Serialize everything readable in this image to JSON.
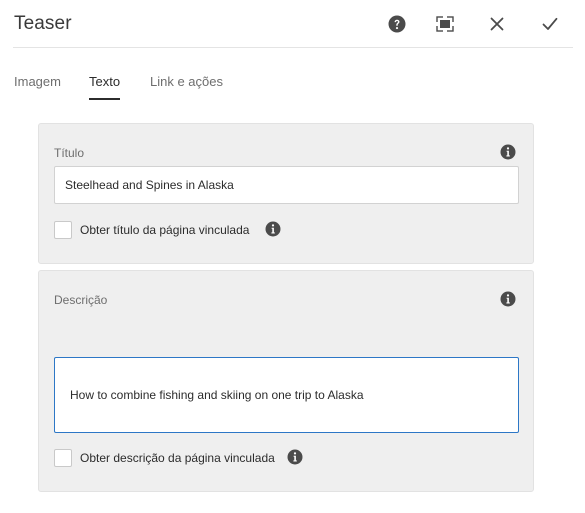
{
  "dialog": {
    "title": "Teaser",
    "actions": {
      "help_icon": "help-icon",
      "fullscreen_icon": "fullscreen-icon",
      "cancel_icon": "close-icon",
      "done_icon": "check-icon"
    }
  },
  "tabs": [
    {
      "label": "Imagem",
      "active": false
    },
    {
      "label": "Texto",
      "active": true
    },
    {
      "label": "Link e ações",
      "active": false
    }
  ],
  "title_section": {
    "label": "Título",
    "value": "Steelhead and Spines in Alaska",
    "checkbox_label": "Obter título da página vinculada",
    "checkbox_checked": false
  },
  "description_section": {
    "label": "Descrição",
    "value": "How to combine fishing and skiing on one trip to Alaska",
    "checkbox_label": "Obter descrição da página vinculada",
    "checkbox_checked": false
  },
  "colors": {
    "focus_border": "#2d77c6",
    "panel_background": "#efefef",
    "icon": "#4b4b4b"
  }
}
